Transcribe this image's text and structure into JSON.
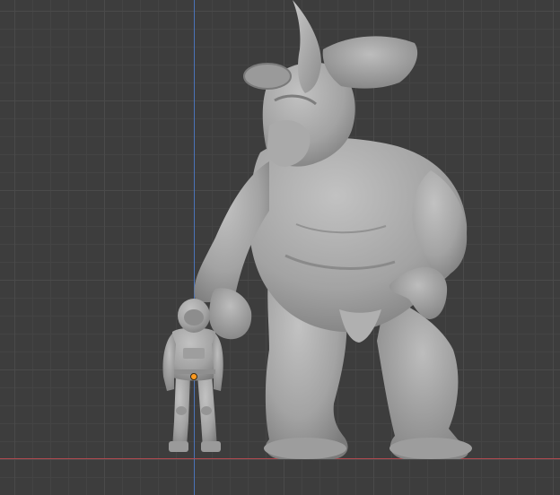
{
  "viewport": {
    "view": "front-orthographic",
    "grid": true,
    "axes": [
      "z-axis",
      "x-axis"
    ],
    "colors": {
      "background": "#3d3d3d",
      "grid_minor": "#444444",
      "grid_major": "#4a4a4a",
      "axis_z": "#4b73b8",
      "axis_x": "#b04a4f",
      "mesh": "#a6a6a6",
      "origin": "#ff9a1f"
    }
  },
  "objects": [
    {
      "id": "astronaut",
      "type": "sculpt-mesh",
      "selected": true
    },
    {
      "id": "rhino-creature",
      "type": "sculpt-mesh",
      "selected": false
    }
  ]
}
